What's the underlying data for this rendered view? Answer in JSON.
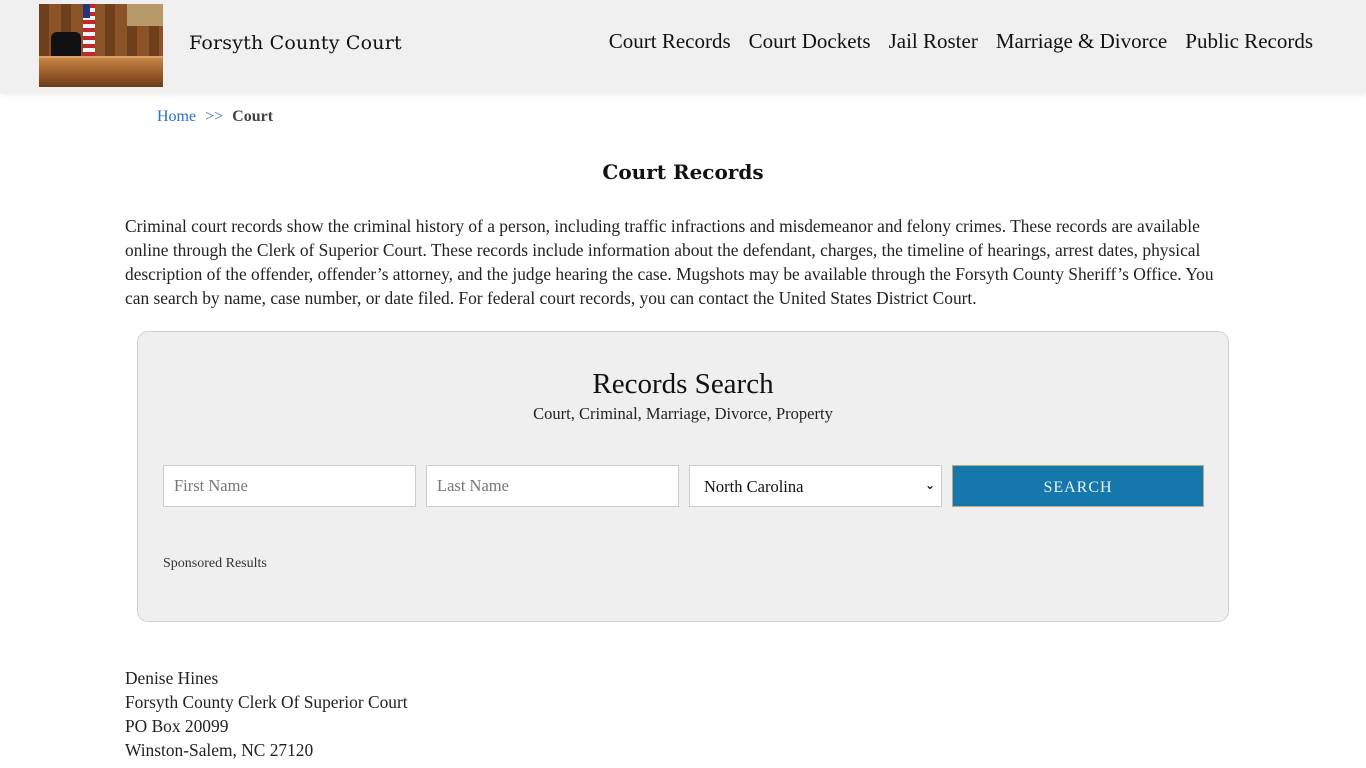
{
  "header": {
    "site_title": "Forsyth County Court",
    "logo_alt": "courtroom-image",
    "nav": [
      {
        "label": "Court Records"
      },
      {
        "label": "Court Dockets"
      },
      {
        "label": "Jail Roster"
      },
      {
        "label": "Marriage & Divorce"
      },
      {
        "label": "Public Records"
      }
    ]
  },
  "breadcrumb": {
    "home": "Home",
    "separator": ">>",
    "current": "Court"
  },
  "page": {
    "title": "Court Records",
    "intro": "Criminal court records show the criminal history of a person, including traffic infractions and misdemeanor and felony crimes. These records are available online through the Clerk of Superior Court. These records include information about the defendant, charges, the timeline of hearings, arrest dates, physical description of the offender, offender’s attorney, and the judge hearing the case. Mugshots may be available through the Forsyth County Sheriff’s Office. You can search by name, case number, or date filed. For federal court records, you can contact the United States District Court."
  },
  "search": {
    "heading": "Records Search",
    "subheading": "Court, Criminal, Marriage, Divorce, Property",
    "first_name_placeholder": "First Name",
    "first_name_value": "",
    "last_name_placeholder": "Last Name",
    "last_name_value": "",
    "state_selected": "North Carolina",
    "button_label": "SEARCH",
    "sponsored_label": "Sponsored Results",
    "colors": {
      "button_bg": "#1677aa",
      "button_text": "#e8f4fb",
      "box_bg": "#efefef"
    }
  },
  "address": {
    "lines": [
      "Denise Hines",
      "Forsyth County Clerk Of Superior Court",
      "PO Box 20099",
      "Winston-Salem, NC 27120"
    ]
  },
  "colors": {
    "header_bg": "#f0f0f0",
    "link": "#2a6fc9"
  }
}
